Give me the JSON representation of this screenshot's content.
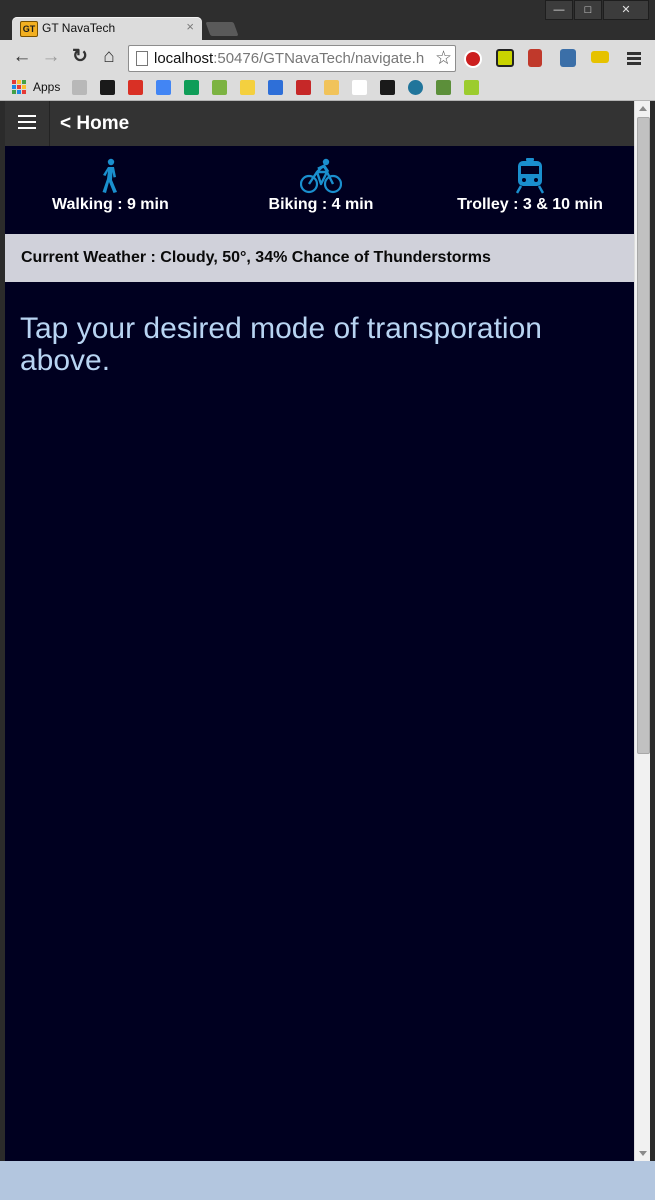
{
  "browser": {
    "tab_title": "GT NavaTech",
    "tab_favicon_text": "GT",
    "tab_close": "×",
    "window_buttons": {
      "minimize": "—",
      "maximize": "□",
      "close": "✕"
    },
    "url_host": "localhost",
    "url_rest": ":50476/GTNavaTech/navigate.h",
    "bookmarks_apps_label": "Apps"
  },
  "app": {
    "home_link": "< Home",
    "modes": [
      {
        "icon": "walking-icon",
        "label": "Walking : 9 min"
      },
      {
        "icon": "bicycle-icon",
        "label": "Biking : 4 min"
      },
      {
        "icon": "trolley-icon",
        "label": "Trolley : 3 & 10 min"
      }
    ],
    "weather": "Current Weather : Cloudy, 50°, 34% Chance of Thunderstorms",
    "prompt": "Tap your desired mode of transporation above."
  },
  "colors": {
    "page_background": "#000020",
    "header_background": "#333333",
    "icon_blue": "#1a8fce",
    "weather_bar": "#d0d1da",
    "prompt_text": "#b8d4f2"
  }
}
